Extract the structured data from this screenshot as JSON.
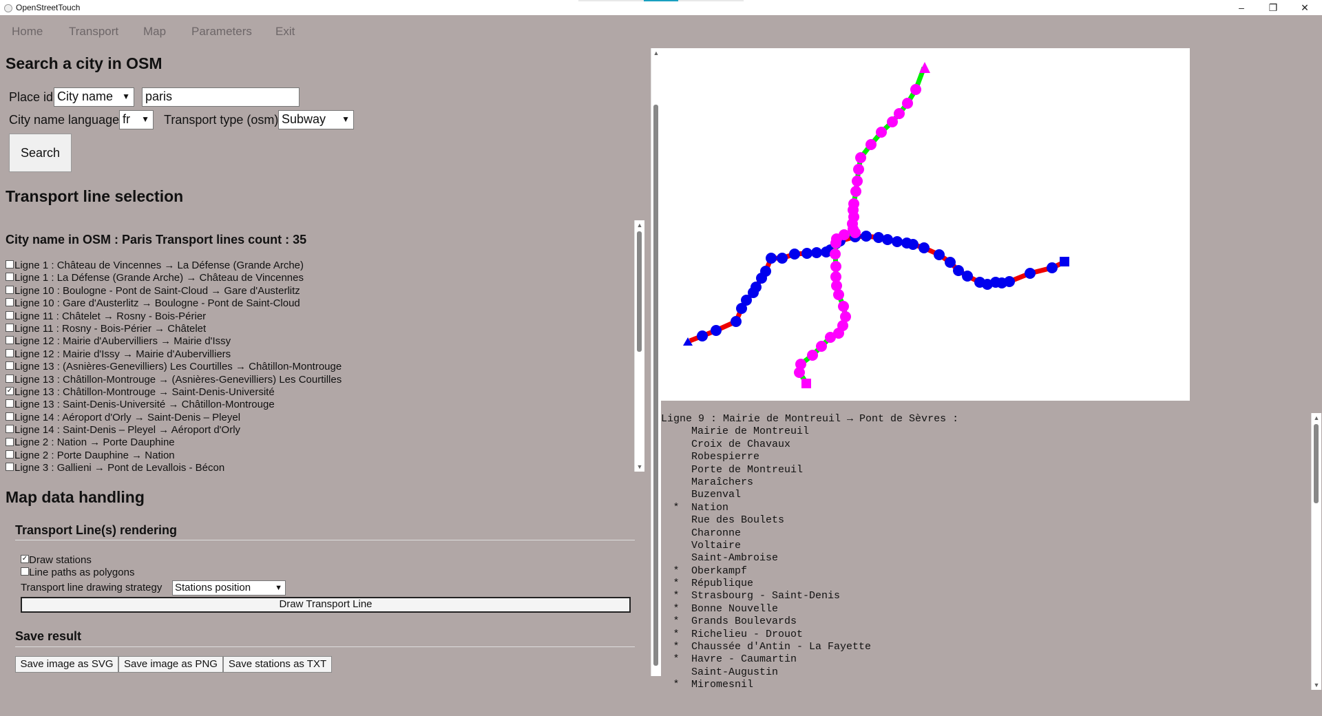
{
  "app": {
    "title": "OpenStreetTouch",
    "minimize": "–",
    "restore": "❐",
    "close": "✕"
  },
  "menu": [
    "Home",
    "Transport",
    "Map",
    "Parameters",
    "Exit"
  ],
  "search": {
    "heading": "Search a city in OSM",
    "place_id_label": "Place id",
    "place_id_type": "City name",
    "city_value": "paris",
    "language_label": "City name language",
    "language_value": "fr",
    "transport_type_label": "Transport type (osm)",
    "transport_type_value": "Subway",
    "search_button": "Search"
  },
  "lines": {
    "heading": "Transport line selection",
    "summary": "City name in OSM : Paris Transport lines count : 35",
    "items": [
      {
        "label": "Ligne 1 : Château de Vincennes → La Défense (Grande Arche)",
        "checked": false
      },
      {
        "label": "Ligne 1 : La Défense (Grande Arche) → Château de Vincennes",
        "checked": false
      },
      {
        "label": "Ligne 10 : Boulogne - Pont de Saint-Cloud → Gare d'Austerlitz",
        "checked": false
      },
      {
        "label": "Ligne 10 : Gare d'Austerlitz → Boulogne - Pont de Saint-Cloud",
        "checked": false
      },
      {
        "label": "Ligne 11 : Châtelet → Rosny - Bois-Périer",
        "checked": false
      },
      {
        "label": "Ligne 11 : Rosny - Bois-Périer → Châtelet",
        "checked": false
      },
      {
        "label": "Ligne 12 : Mairie d'Aubervilliers → Mairie d'Issy",
        "checked": false
      },
      {
        "label": "Ligne 12 : Mairie d'Issy → Mairie d'Aubervilliers",
        "checked": false
      },
      {
        "label": "Ligne 13 : (Asnières-Genevilliers) Les Courtilles → Châtillon-Montrouge",
        "checked": false
      },
      {
        "label": "Ligne 13 : Châtillon-Montrouge → (Asnières-Genevilliers) Les Courtilles",
        "checked": false
      },
      {
        "label": "Ligne 13 : Châtillon-Montrouge → Saint-Denis-Université",
        "checked": true
      },
      {
        "label": "Ligne 13 : Saint-Denis-Université → Châtillon-Montrouge",
        "checked": false
      },
      {
        "label": "Ligne 14 : Aéroport d'Orly → Saint-Denis – Pleyel",
        "checked": false
      },
      {
        "label": "Ligne 14 : Saint-Denis – Pleyel → Aéroport d'Orly",
        "checked": false
      },
      {
        "label": "Ligne 2 : Nation → Porte Dauphine",
        "checked": false
      },
      {
        "label": "Ligne 2 : Porte Dauphine → Nation",
        "checked": false
      },
      {
        "label": "Ligne 3 : Gallieni → Pont de Levallois - Bécon",
        "checked": false
      }
    ]
  },
  "mapdata": {
    "heading": "Map data handling",
    "rendering_heading": "Transport Line(s) rendering",
    "draw_stations_label": "Draw stations",
    "draw_stations_checked": true,
    "polygons_label": "Line paths as polygons",
    "polygons_checked": false,
    "strategy_label": "Transport line drawing strategy",
    "strategy_value": "Stations position",
    "draw_button": "Draw Transport Line",
    "save_heading": "Save result",
    "save_svg": "Save image as SVG",
    "save_png": "Save image as PNG",
    "save_txt": "Save stations as TXT"
  },
  "colors": {
    "line13_path": "#00ee00",
    "line13_station": "#ff00ff",
    "line9_path": "#ee0000",
    "line9_station": "#0000ee"
  },
  "stations": {
    "header": "Ligne 9 : Mairie de Montreuil → Pont de Sèvres :",
    "items": [
      {
        "name": "Mairie de Montreuil",
        "star": false
      },
      {
        "name": "Croix de Chavaux",
        "star": false
      },
      {
        "name": "Robespierre",
        "star": false
      },
      {
        "name": "Porte de Montreuil",
        "star": false
      },
      {
        "name": "Maraîchers",
        "star": false
      },
      {
        "name": "Buzenval",
        "star": false
      },
      {
        "name": "Nation",
        "star": true
      },
      {
        "name": "Rue des Boulets",
        "star": false
      },
      {
        "name": "Charonne",
        "star": false
      },
      {
        "name": "Voltaire",
        "star": false
      },
      {
        "name": "Saint-Ambroise",
        "star": false
      },
      {
        "name": "Oberkampf",
        "star": true
      },
      {
        "name": "République",
        "star": true
      },
      {
        "name": "Strasbourg - Saint-Denis",
        "star": true
      },
      {
        "name": "Bonne Nouvelle",
        "star": true
      },
      {
        "name": "Grands Boulevards",
        "star": true
      },
      {
        "name": "Richelieu - Drouot",
        "star": true
      },
      {
        "name": "Chaussée d'Antin - La Fayette",
        "star": true
      },
      {
        "name": "Havre - Caumartin",
        "star": true
      },
      {
        "name": "Saint-Augustin",
        "star": false
      },
      {
        "name": "Miromesnil",
        "star": true
      }
    ]
  }
}
